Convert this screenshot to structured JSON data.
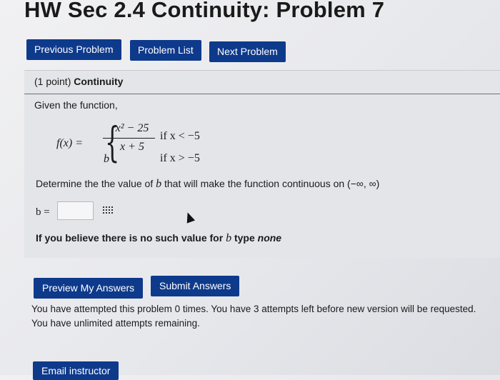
{
  "page": {
    "title": "HW Sec 2.4 Continuity: Problem 7"
  },
  "nav": {
    "previous": "Previous Problem",
    "list": "Problem List",
    "next": "Next Problem"
  },
  "problem": {
    "points": "(1 point)",
    "topic": "Continuity",
    "given": "Given the function,",
    "fx": "f(x) =",
    "numerator": "x² − 25",
    "denominator": "x + 5",
    "case2_value": "b",
    "cond1": "if x < −5",
    "cond2": "if x > −5",
    "determine_pre": "Determine the the value of ",
    "determine_var": "b",
    "determine_post": " that will make the function continuous on (−∞, ∞)",
    "answer_label": "b =",
    "answer_value": "",
    "believe_pre": "If you believe there is no such value for ",
    "believe_var": "b",
    "believe_mid": " type ",
    "believe_none": "none"
  },
  "actions": {
    "preview": "Preview My Answers",
    "submit": "Submit Answers",
    "email": "Email instructor"
  },
  "status": {
    "attempts_line1": "You have attempted this problem 0 times. You have 3 attempts left before new version will be requested.",
    "attempts_line2": "You have unlimited attempts remaining."
  },
  "icons": {
    "answer_tool": "grid-icon",
    "pointer": "cursor-icon"
  },
  "colors": {
    "button_bg": "#0e3a8c",
    "button_text": "#ffffff"
  }
}
